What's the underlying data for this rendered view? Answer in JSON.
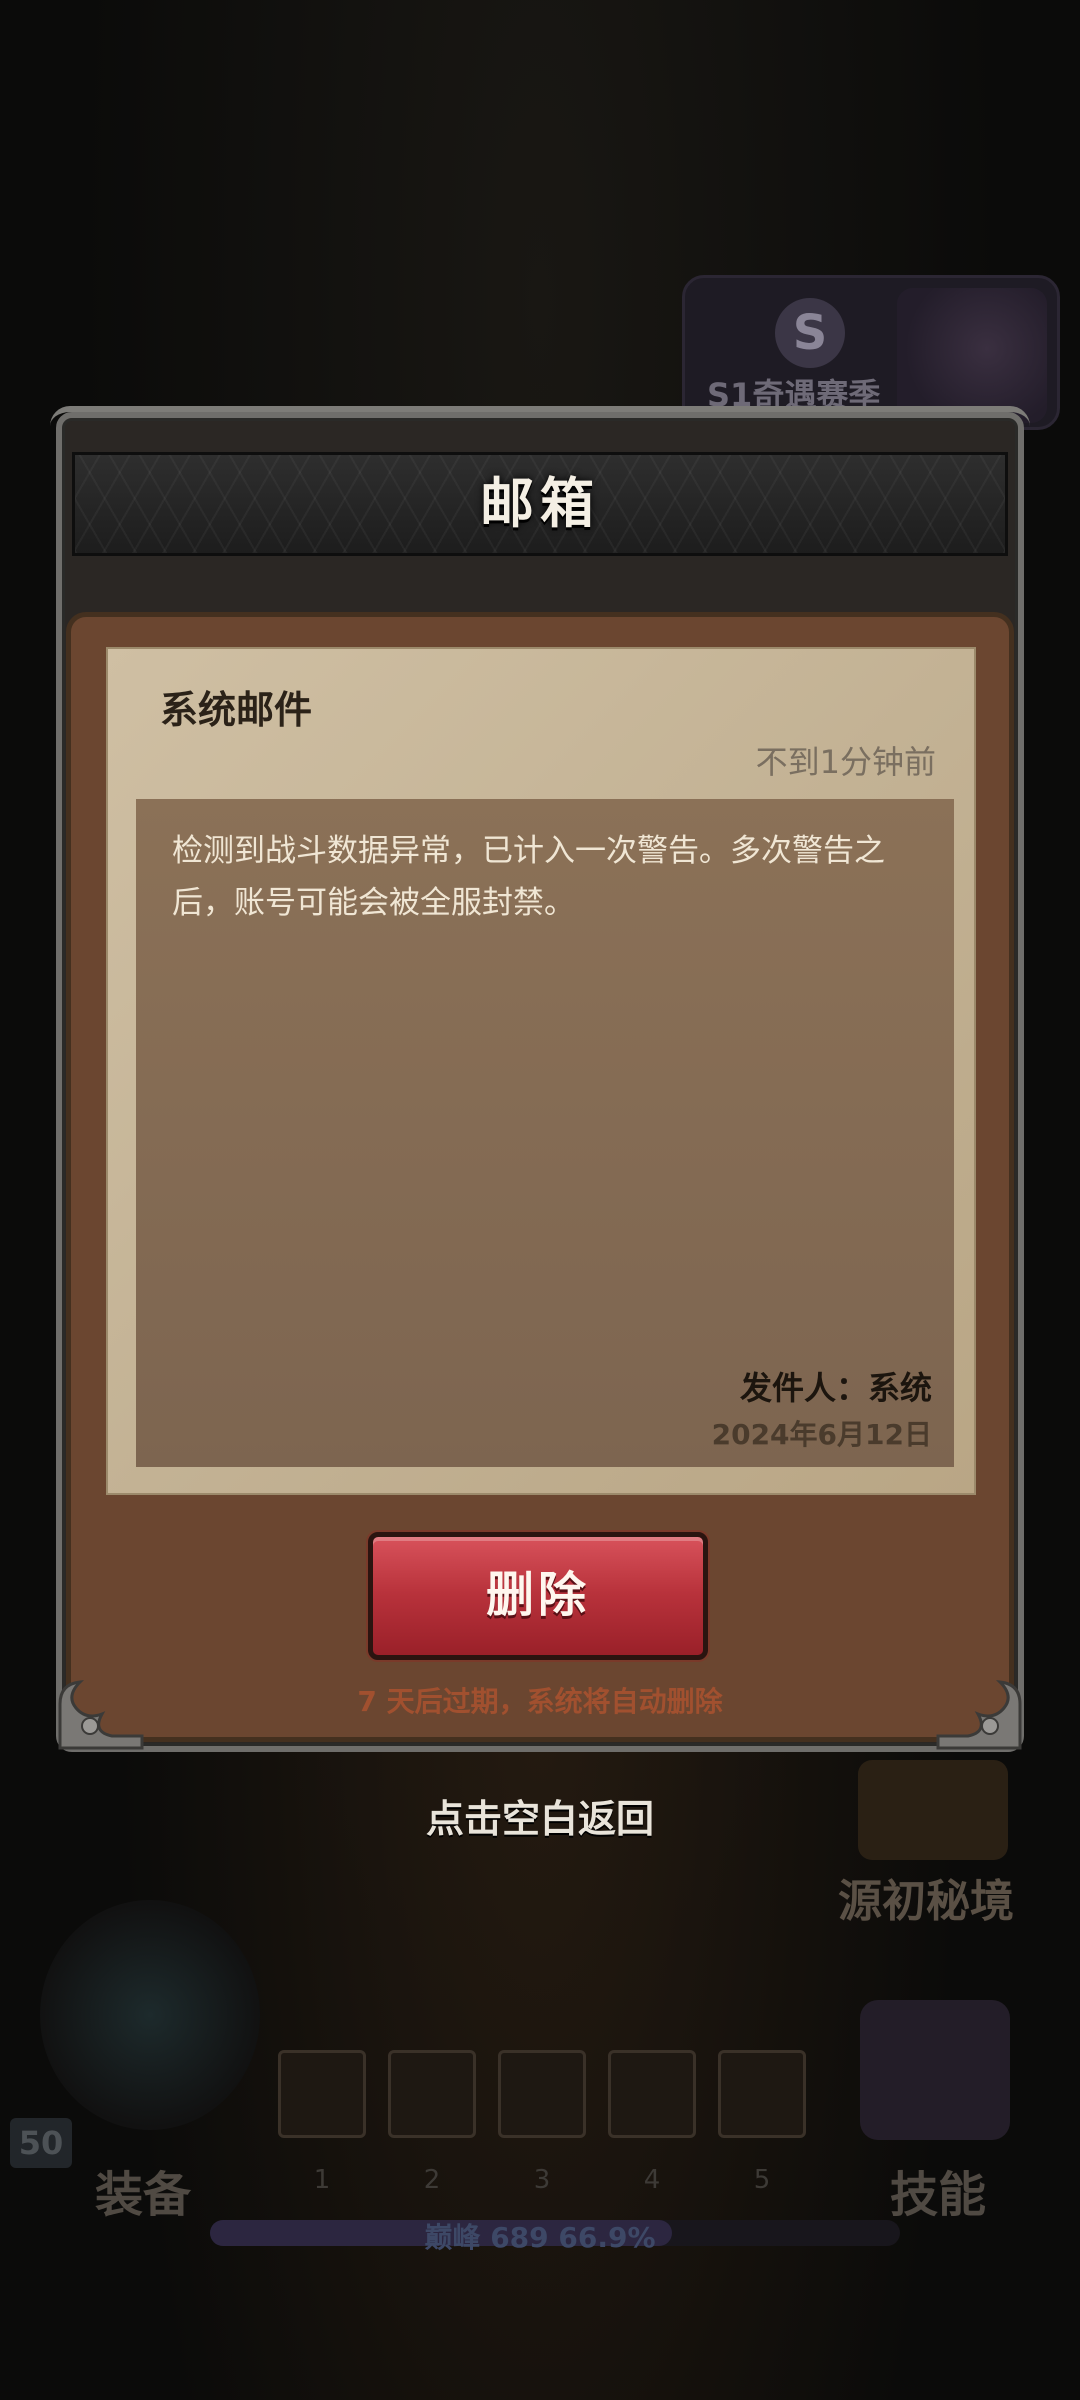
{
  "background": {
    "season_badge": {
      "letter": "S",
      "label": "S1奇遇赛季"
    },
    "right_feature_label": "源初秘境",
    "equip_label": "装备",
    "skill_label": "技能",
    "level": "50",
    "slot_numbers": [
      "1",
      "2",
      "3",
      "4",
      "5"
    ],
    "peak": {
      "label": "巅峰 689",
      "percent": "66.9%",
      "progress": 0.669
    }
  },
  "dialog": {
    "title": "邮箱",
    "mail": {
      "subject": "系统邮件",
      "time": "不到1分钟前",
      "body": "检测到战斗数据异常，已计入一次警告。多次警告之后，账号可能会被全服封禁。",
      "sender": "发件人：系统",
      "date": "2024年6月12日"
    },
    "delete_label": "删除",
    "expire_note": "7 天后过期，系统将自动删除"
  },
  "tap_return": "点击空白返回",
  "colors": {
    "delete_button": "#b8323b",
    "panel_brown": "#6b4630",
    "paper": "#c2b193",
    "expire_text": "#a1502f"
  }
}
